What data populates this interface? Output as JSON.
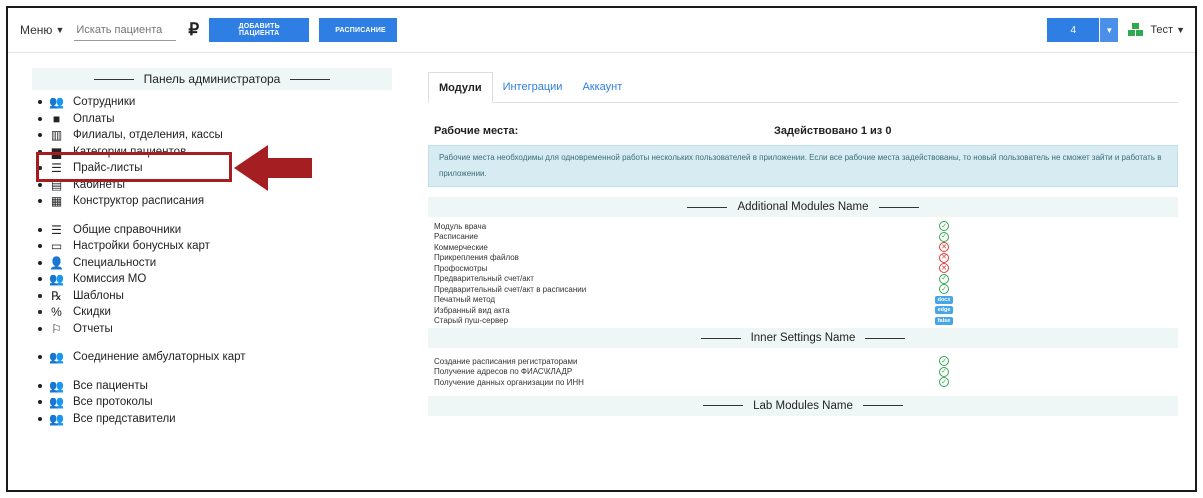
{
  "topbar": {
    "menu_label": "Меню",
    "search_placeholder": "Искать пациента",
    "currency_symbol": "₽",
    "add_patient_label": "ДОБАВИТЬ ПАЦИЕНТА",
    "schedule_label": "РАСПИСАНИЕ",
    "notifications_count": "4",
    "user_name": "Тест"
  },
  "admin_panel": {
    "title": "Панель администратора",
    "items": [
      {
        "label": "Сотрудники",
        "icon": "users-group-icon"
      },
      {
        "label": "Оплаты",
        "icon": "cash-icon"
      },
      {
        "label": "Филиалы, отделения, кассы",
        "icon": "building-icon"
      },
      {
        "label": "Категории пациентов",
        "icon": "folder-icon",
        "highlighted": true
      },
      {
        "label": "Прайс-листы",
        "icon": "list-icon"
      },
      {
        "label": "Кабинеты",
        "icon": "door-icon"
      },
      {
        "label": "Конструктор расписания",
        "icon": "calendar-icon"
      },
      {
        "label": "Общие справочники",
        "icon": "list-icon",
        "gap": true
      },
      {
        "label": "Настройки бонусных карт",
        "icon": "card-icon"
      },
      {
        "label": "Специальности",
        "icon": "doctor-icon"
      },
      {
        "label": "Комиссия МО",
        "icon": "users-group-icon"
      },
      {
        "label": "Шаблоны",
        "icon": "prescription-icon"
      },
      {
        "label": "Скидки",
        "icon": "percent-icon"
      },
      {
        "label": "Отчеты",
        "icon": "flag-icon"
      },
      {
        "label": "Соединение амбулаторных карт",
        "icon": "users-group-icon",
        "gap": true
      },
      {
        "label": "Все пациенты",
        "icon": "users-group-icon",
        "gap": true
      },
      {
        "label": "Все протоколы",
        "icon": "users-group-icon"
      },
      {
        "label": "Все представители",
        "icon": "users-group-icon"
      }
    ]
  },
  "tabs": [
    {
      "label": "Модули",
      "active": true
    },
    {
      "label": "Интеграции",
      "active": false
    },
    {
      "label": "Аккаунт",
      "active": false
    }
  ],
  "workplaces": {
    "label": "Рабочие места:",
    "used": "Задействовано 1 из 0",
    "info": "Рабочие места необходимы для одновременной работы нескольких пользователей в приложении. Если все рабочие места задействованы, то новый пользователь не сможет зайти и работать в приложении."
  },
  "sections": [
    {
      "title": "Additional Modules Name",
      "rows": [
        {
          "name": "Модуль врача",
          "status": "ok"
        },
        {
          "name": "Расписание",
          "status": "ok"
        },
        {
          "name": "Коммерческие",
          "status": "no"
        },
        {
          "name": "Прикрепления файлов",
          "status": "no"
        },
        {
          "name": "Профосмотры",
          "status": "no"
        },
        {
          "name": "Предварительный счет/акт",
          "status": "ok"
        },
        {
          "name": "Предварительный счет/акт в расписании",
          "status": "ok"
        },
        {
          "name": "Печатный метод",
          "status": "badge",
          "value": "docx"
        },
        {
          "name": "Избранный вид акта",
          "status": "badge",
          "value": "edge"
        },
        {
          "name": "Старый пуш-сервер",
          "status": "badge",
          "value": "false"
        }
      ]
    },
    {
      "title": "Inner Settings Name",
      "rows": [
        {
          "name": "Создание расписания регистраторами",
          "status": "ok"
        },
        {
          "name": "Получение адресов по ФИАС\\КЛАДР",
          "status": "ok"
        },
        {
          "name": "Получение данных организации по ИНН",
          "status": "ok"
        }
      ]
    },
    {
      "title": "Lab Modules Name",
      "rows": []
    }
  ],
  "colors": {
    "primary": "#2f7ee3",
    "highlight_border": "#a41e22",
    "ok": "#32a852",
    "error": "#e03b3b",
    "badge": "#46a6e8"
  }
}
